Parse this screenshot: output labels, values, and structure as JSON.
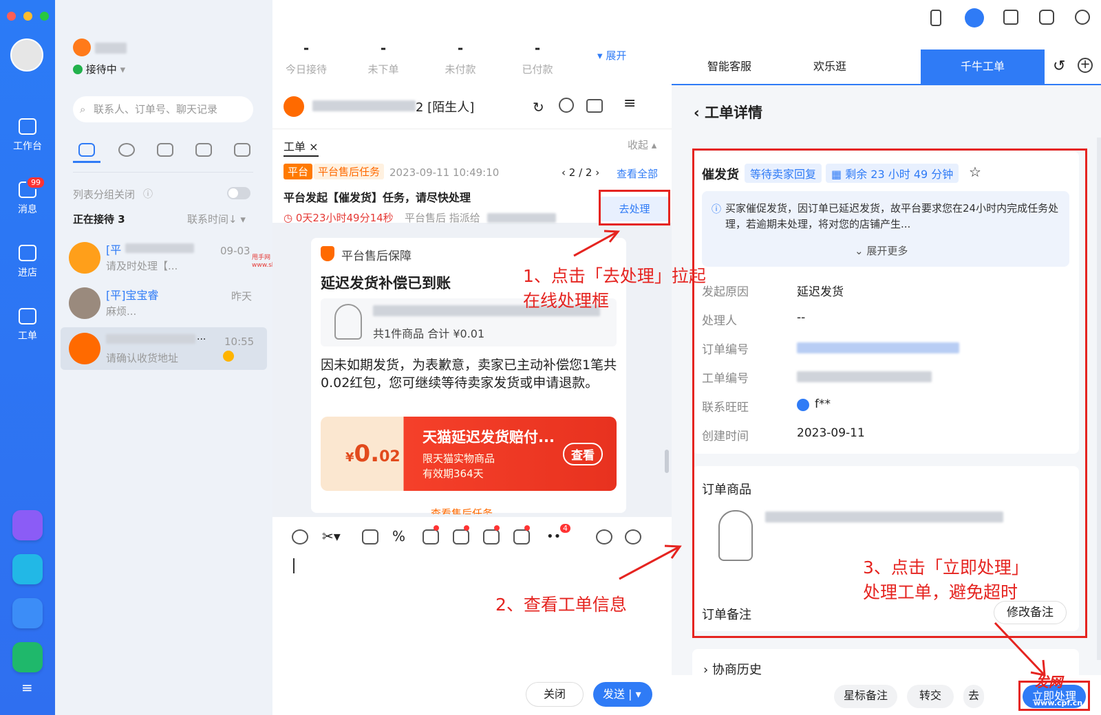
{
  "user": {
    "status": "接待中"
  },
  "stats": [
    {
      "value": "-",
      "label": "今日接待"
    },
    {
      "value": "-",
      "label": "未下单"
    },
    {
      "value": "-",
      "label": "未付款"
    },
    {
      "value": "-",
      "label": "已付款"
    }
  ],
  "stats_expand": "展开",
  "rail": {
    "workbench": "工作台",
    "messages": "消息",
    "messages_badge": "99",
    "store": "进店",
    "ticket": "工单"
  },
  "search": {
    "placeholder": "联系人、订单号、聊天记录"
  },
  "list": {
    "group_toggle": "列表分组关闭",
    "serving": "正在接待",
    "serving_count": "3",
    "sort": "联系时间↓"
  },
  "contacts": [
    {
      "tag": "[平",
      "time": "09-03",
      "preview": "请及时处理【..."
    },
    {
      "tag": "[平]宝宝睿",
      "time": "昨天",
      "preview": "麻烦..."
    },
    {
      "name": "...",
      "time": "10:55",
      "preview": "请确认收货地址"
    }
  ],
  "chat": {
    "title_suffix": "2 [陌生人]"
  },
  "ticket": {
    "tab": "工单",
    "collapse": "收起",
    "tag_platform": "平台",
    "tag_task": "平台售后任务",
    "datetime": "2023-09-11 10:49:10",
    "pager": "2 / 2",
    "view_all": "查看全部",
    "title": "平台发起【催发货】任务，请尽快处理",
    "process": "去处理",
    "countdown": "0天23小时49分14秒",
    "assigned": "平台售后 指派给"
  },
  "msg": {
    "guarantee": "平台售后保障",
    "title": "延迟发货补偿已到账",
    "summary": "共1件商品  合计 ¥0.01",
    "body": "因未如期发货，为表歉意，卖家已主动补偿您1笔共0.02红包，您可继续等待卖家发货或申请退款。",
    "coupon_title": "天猫延迟发货赔付...",
    "coupon_sub": "限天猫实物商品",
    "coupon_valid": "有效期364天",
    "coupon_view": "查看",
    "coupon_yen": "¥",
    "coupon_amount": "0.",
    "coupon_amount_dec": "02",
    "more": "查看售后任务"
  },
  "toolbar": {
    "badge": "4"
  },
  "footer": {
    "close": "关闭",
    "send": "发送"
  },
  "rtabs": {
    "smart": "智能客服",
    "fun": "欢乐逛",
    "qianniu": "千牛工单"
  },
  "detail": {
    "back_title": "工单详情",
    "type": "催发货",
    "status": "等待卖家回复",
    "remaining": "剩余 23 小时 49 分钟",
    "notice": "买家催促发货，因订单已延迟发货，故平台要求您在24小时内完成任务处理，若逾期未处理，将对您的店铺产生...",
    "expand_more": "展开更多",
    "fields": [
      {
        "label": "发起原因",
        "value": "延迟发货"
      },
      {
        "label": "处理人",
        "value": "--"
      },
      {
        "label": "订单编号",
        "value": ""
      },
      {
        "label": "工单编号",
        "value": ""
      },
      {
        "label": "联系旺旺",
        "value": "f**"
      },
      {
        "label": "创建时间",
        "value": "2023-09-11"
      }
    ],
    "order_goods": "订单商品",
    "order_note": "订单备注",
    "edit_note": "修改备注",
    "history": "协商历史",
    "btn_star": "星标备注",
    "btn_transfer": "转交",
    "btn_go": "去",
    "btn_now": "立即处理"
  },
  "annotations": {
    "a1_line1": "1、点击「去处理」拉起",
    "a1_line2": "在线处理框",
    "a2": "2、查看工单信息",
    "a3_line1": "3、点击「立即处理」",
    "a3_line2": "处理工单，避免超时"
  },
  "watermarks": {
    "shuaishou": "甩手网",
    "shuaishou_url": "www.shuaishou.com",
    "cpf": "一发网",
    "cpf_url": "www.cpf.cn"
  },
  "colors": {
    "rail": "#2f76f4",
    "accent": "#2f7bf6",
    "orange": "#ff6a00",
    "annot": "#e52420"
  }
}
